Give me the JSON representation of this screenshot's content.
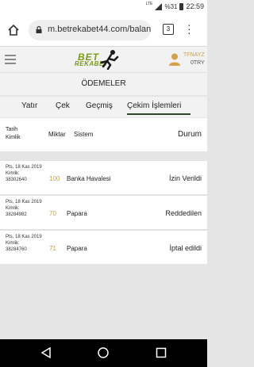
{
  "status_bar": {
    "network": "LTE",
    "battery": "%31",
    "time": "22:59"
  },
  "browser": {
    "url": "m.betrekabet44.com/balan",
    "tabs_count": "3"
  },
  "header": {
    "logo_top": "BET",
    "logo_bottom": "REKABET",
    "username": "TFNAYZ",
    "balance": "0TRY"
  },
  "page": {
    "title": "ÖDEMELER"
  },
  "tabs": [
    {
      "label": "Yatır"
    },
    {
      "label": "Çek"
    },
    {
      "label": "Geçmiş"
    },
    {
      "label": "Çekim İşlemleri"
    }
  ],
  "table": {
    "headers": {
      "date": "Tarih",
      "id": "Kimlik",
      "amount": "Miktar",
      "system": "Sistem",
      "status": "Durum"
    },
    "rows": [
      {
        "date": "Pts, 18 Kas 2019",
        "id_label": "Kimlik:",
        "id": "38302640",
        "amount": "100",
        "system": "Banka Havalesi",
        "status": "İzin Verildi"
      },
      {
        "date": "Pts, 18 Kas 2019",
        "id_label": "Kimlik:",
        "id": "38284982",
        "amount": "70",
        "system": "Papara",
        "status": "Reddedilen"
      },
      {
        "date": "Pts, 18 Kas 2019",
        "id_label": "Kimlik:",
        "id": "38284760",
        "amount": "71",
        "system": "Papara",
        "status": "İptal edildi"
      }
    ]
  },
  "colors": {
    "accent_green": "#2b4a24",
    "logo_green": "#7a9a16",
    "gold": "#c8a04a"
  }
}
